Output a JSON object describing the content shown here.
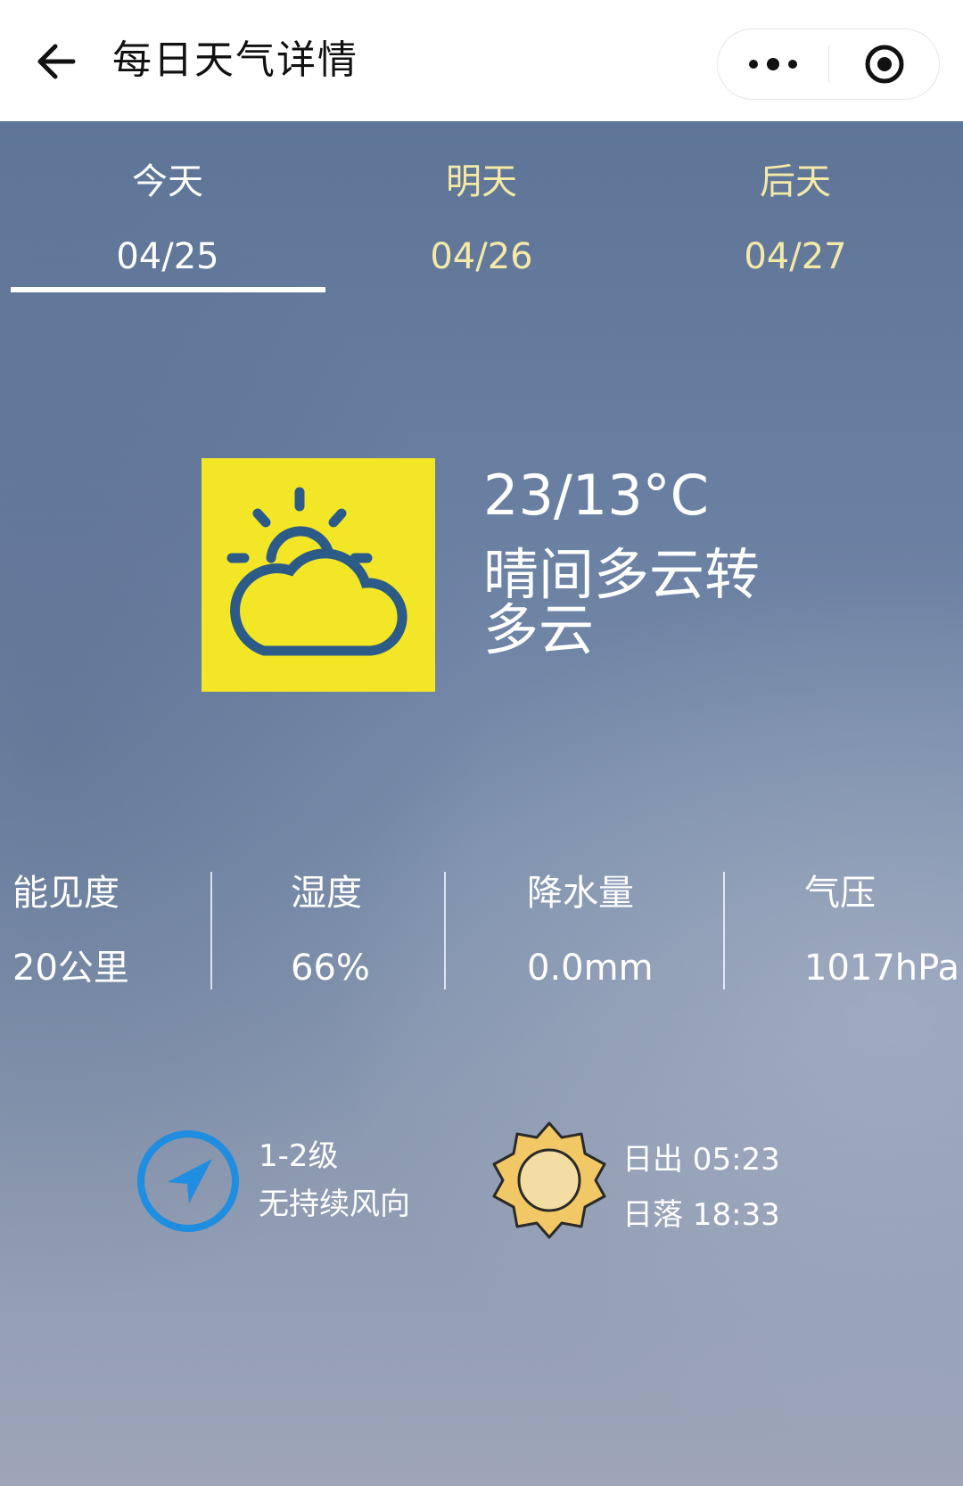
{
  "navbar": {
    "title": "每日天气详情"
  },
  "tabs": [
    {
      "day": "今天",
      "date": "04/25"
    },
    {
      "day": "明天",
      "date": "04/26"
    },
    {
      "day": "后天",
      "date": "04/27"
    }
  ],
  "selected_tab": 0,
  "weather": {
    "icon": "partly-cloudy-icon",
    "temperature": "23/13°C",
    "condition": "晴间多云转多云"
  },
  "stats": [
    {
      "label": "能见度",
      "value": "20公里"
    },
    {
      "label": "湿度",
      "value": "66%"
    },
    {
      "label": "降水量",
      "value": "0.0mm"
    },
    {
      "label": "气压",
      "value": "1017hPa"
    }
  ],
  "wind": {
    "icon": "wind-direction-icon",
    "level": "1-2级",
    "direction": "无持续风向"
  },
  "sun": {
    "icon": "sun-icon",
    "sunrise": "日出 05:23",
    "sunset": "日落 18:33"
  },
  "colors": {
    "icon_box": "#f3e627",
    "icon_stroke": "#2d5b88",
    "inactive_tab_text": "#f5e9a8",
    "wind_icon": "#1f8de0",
    "sun_fill": "#f1c865",
    "sun_core": "#f3dda3"
  }
}
